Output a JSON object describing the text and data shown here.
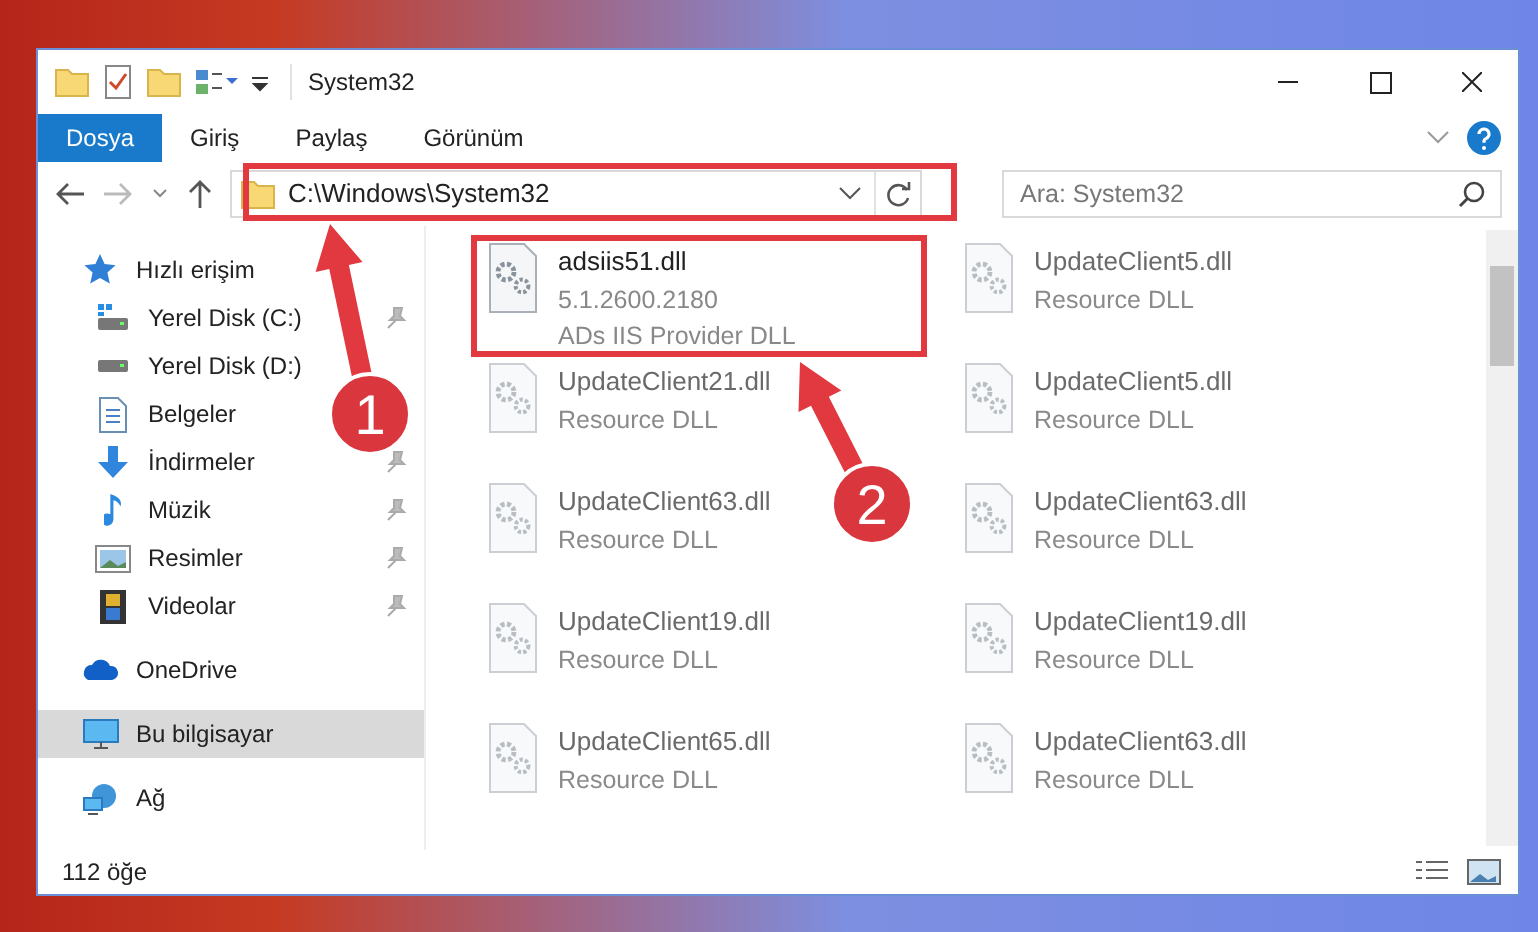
{
  "window": {
    "title": "System32"
  },
  "ribbon": {
    "tabs": [
      {
        "label": "Dosya",
        "selected": true
      },
      {
        "label": "Giriş",
        "selected": false
      },
      {
        "label": "Paylaş",
        "selected": false
      },
      {
        "label": "Görünüm",
        "selected": false
      }
    ]
  },
  "address_bar": {
    "path": "C:\\Windows\\System32"
  },
  "search": {
    "placeholder": "Ara: System32"
  },
  "sidebar": {
    "items": [
      {
        "label": "Hızlı erişim",
        "kind": "star",
        "selected": false,
        "children": [
          {
            "label": "Yerel Disk (C:)",
            "kind": "drive-c",
            "pinned": true
          },
          {
            "label": "Yerel Disk (D:)",
            "kind": "drive",
            "pinned": false
          },
          {
            "label": "Belgeler",
            "kind": "doc",
            "pinned": false
          },
          {
            "label": "İndirmeler",
            "kind": "download",
            "pinned": true
          },
          {
            "label": "Müzik",
            "kind": "music",
            "pinned": true
          },
          {
            "label": "Resimler",
            "kind": "pictures",
            "pinned": true
          },
          {
            "label": "Videolar",
            "kind": "video",
            "pinned": true
          }
        ]
      },
      {
        "label": "OneDrive",
        "kind": "cloud",
        "selected": false
      },
      {
        "label": "Bu bilgisayar",
        "kind": "computer",
        "selected": true
      },
      {
        "label": "Ağ",
        "kind": "network",
        "selected": false
      }
    ]
  },
  "files": [
    {
      "name": "adsiis51.dll",
      "details": [
        "5.1.2600.2180",
        "ADs IIS Provider DLL"
      ],
      "blurred": false
    },
    {
      "name": "UpdateClient5.dll",
      "details": [
        "Resource DLL"
      ],
      "blurred": true
    },
    {
      "name": "UpdateClient21.dll",
      "details": [
        "Resource DLL"
      ],
      "blurred": true
    },
    {
      "name": "UpdateClient5.dll",
      "details": [
        "Resource DLL"
      ],
      "blurred": true
    },
    {
      "name": "UpdateClient63.dll",
      "details": [
        "Resource DLL"
      ],
      "blurred": true
    },
    {
      "name": "UpdateClient63.dll",
      "details": [
        "Resource DLL"
      ],
      "blurred": true
    },
    {
      "name": "UpdateClient19.dll",
      "details": [
        "Resource DLL"
      ],
      "blurred": true
    },
    {
      "name": "UpdateClient19.dll",
      "details": [
        "Resource DLL"
      ],
      "blurred": true
    },
    {
      "name": "UpdateClient65.dll",
      "details": [
        "Resource DLL"
      ],
      "blurred": true
    },
    {
      "name": "UpdateClient63.dll",
      "details": [
        "Resource DLL"
      ],
      "blurred": true
    }
  ],
  "status_bar": {
    "item_count": "112 öğe"
  },
  "annotations": [
    {
      "number": "1"
    },
    {
      "number": "2"
    }
  ]
}
